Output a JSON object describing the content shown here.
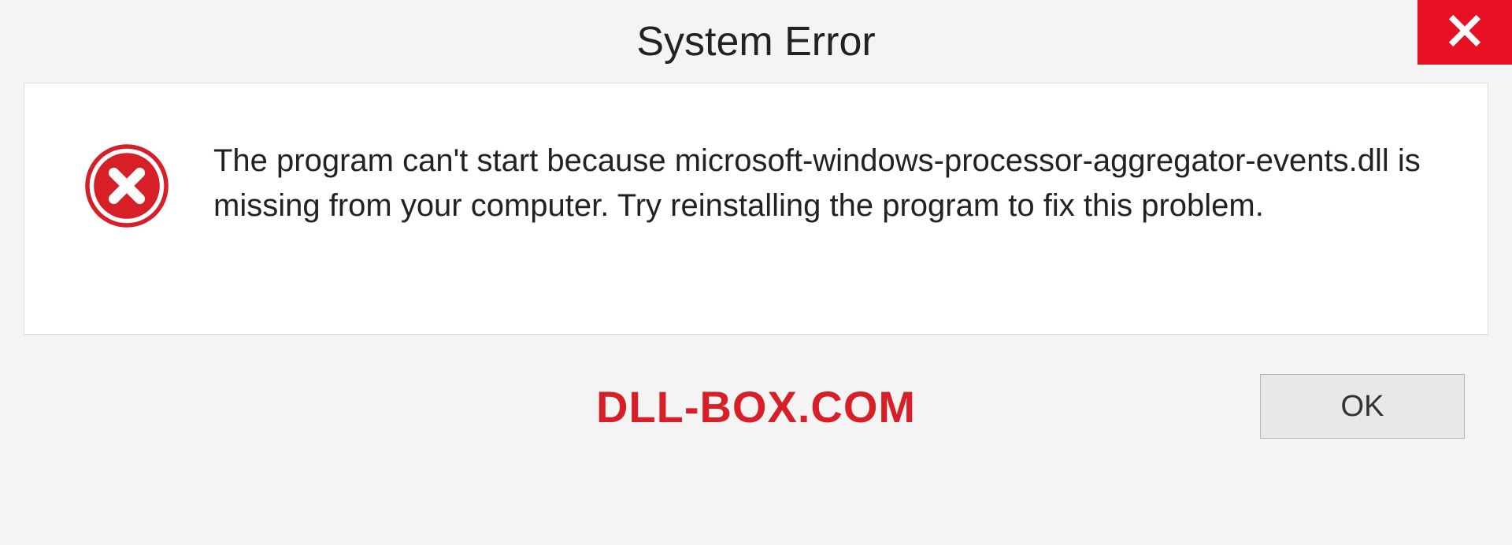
{
  "dialog": {
    "title": "System Error",
    "message": "The program can't start because microsoft-windows-processor-aggregator-events.dll is missing from your computer. Try reinstalling the program to fix this problem.",
    "ok_label": "OK"
  },
  "watermark": "DLL-BOX.COM",
  "colors": {
    "close_red": "#e81123",
    "watermark_red": "#d61f26"
  }
}
